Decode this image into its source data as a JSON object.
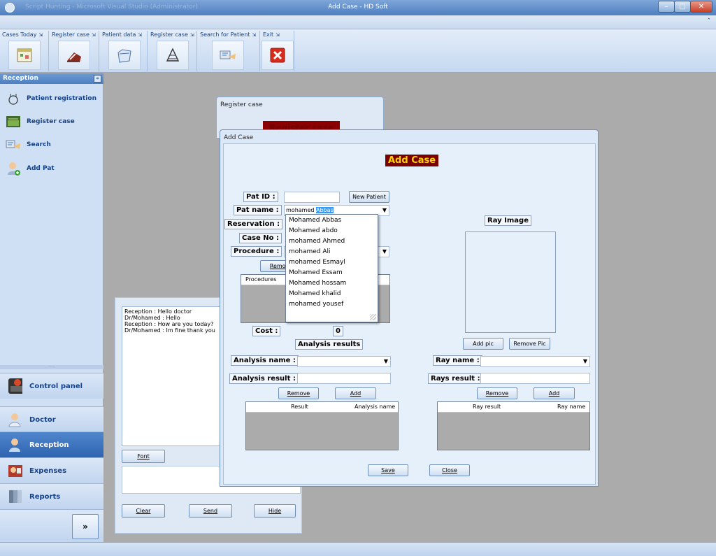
{
  "window": {
    "title": "Add Case - HD Soft",
    "faded_title": "Script Hunting - Microsoft Visual Studio (Administrator)",
    "controls": {
      "minimize": "–",
      "maximize": "□",
      "close": "✕"
    }
  },
  "ribbon": {
    "collapse_glyph": "ˆ",
    "groups": [
      {
        "label": "Cases Today",
        "icon": "calendar-icon"
      },
      {
        "label": "Register case",
        "icon": "medical-bag-icon"
      },
      {
        "label": "Patient data",
        "icon": "folder-icon"
      },
      {
        "label": "Register case",
        "icon": "compass-icon"
      },
      {
        "label": "Search for Patient",
        "icon": "search-card-icon"
      },
      {
        "label": "Exit",
        "icon": "exit-icon"
      }
    ]
  },
  "nav": {
    "header": "Reception",
    "items": [
      {
        "label": "Patient registration",
        "icon": "stethoscope-icon"
      },
      {
        "label": "Register case",
        "icon": "register-case-icon"
      },
      {
        "label": "Search",
        "icon": "search-card-icon"
      },
      {
        "label": "Add Pat",
        "icon": "add-user-icon"
      }
    ],
    "sections": [
      {
        "label": "Control panel",
        "icon": "control-panel-icon"
      },
      {
        "label": "Doctor",
        "icon": "doctor-icon"
      },
      {
        "label": "Reception",
        "icon": "reception-icon"
      },
      {
        "label": "Expenses",
        "icon": "expenses-icon"
      },
      {
        "label": "Reports",
        "icon": "reports-icon"
      }
    ],
    "more_glyph": "»"
  },
  "chat": {
    "log": "Reception : Hello doctor\nDr/Mohamed : Hello\nReception : How are you today?\nDr/Mohamed : Im fine thank you",
    "font_label": "Font",
    "clear_label": "Clear",
    "send_label": "Send",
    "hide_label": "Hide"
  },
  "register_window": {
    "title": "Register case",
    "banner": "Register case"
  },
  "add_case": {
    "window_title": "Add Case",
    "heading": "Add Case",
    "pat_id_label": "Pat ID :",
    "pat_id_value": "",
    "new_patient_label": "New Patient",
    "pat_name_label": "Pat name :",
    "pat_name_typed": "mohamed ",
    "pat_name_suggest": "Abbas",
    "reservation_label": "Reservation :",
    "case_no_label": "Case No :",
    "procedure_label": "Procedure :",
    "remove_procedure_label": "Remove",
    "procedures_header": "Procedures",
    "cost_label": "Cost :",
    "cost_value": "0",
    "analysis_results_heading": "Analysis results",
    "analysis_name_label": "Analysis name :",
    "analysis_result_label": "Analysis result :",
    "analysis_remove_label": "Remove",
    "analysis_add_label": "Add",
    "analysis_grid_headers": [
      "Result",
      "Analysis name"
    ],
    "ray_image_heading": "Ray Image",
    "add_pic_label": "Add pic",
    "remove_pic_label": "Remove Pic",
    "ray_name_label": "Ray name :",
    "rays_result_label": "Rays result :",
    "ray_remove_label": "Remove",
    "ray_add_label": "Add",
    "ray_grid_headers": [
      "Ray result",
      "Ray name"
    ],
    "save_label": "Save",
    "close_label": "Close",
    "suggestions": [
      "Mohamed Abbas",
      "Mohamed abdo",
      "mohamed Ahmed",
      "mohamed Ali",
      "mohamed Esmayl",
      "Mohamed Essam",
      "Mohamed hossam",
      "Mohamed khalid",
      "mohamed yousef"
    ]
  },
  "colors": {
    "title_banner_bg": "#7a0000",
    "title_banner_fg": "#ffd400",
    "selection": "#3399ff",
    "active_nav": "#2f64b0",
    "exit_red": "#d92b1b"
  }
}
